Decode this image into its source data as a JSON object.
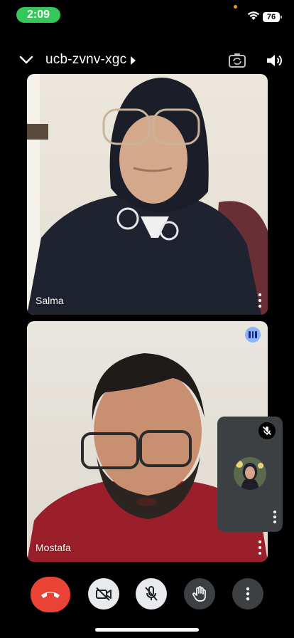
{
  "status_bar": {
    "time": "2:09",
    "battery": "76"
  },
  "top_bar": {
    "meeting_code": "ucb-zvnv-xgc"
  },
  "participants": [
    {
      "name": "Salma"
    },
    {
      "name": "Mostafa"
    }
  ],
  "colors": {
    "end_call": "#ea4335",
    "speaking": "#8ab4f8",
    "time_pill": "#34c759"
  }
}
